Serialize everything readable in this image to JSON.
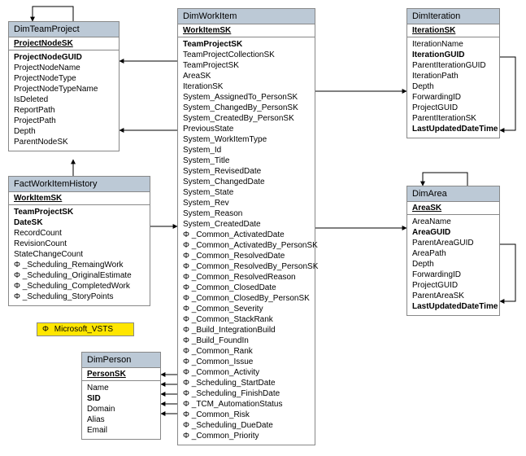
{
  "legend": {
    "symbol": "Φ",
    "label": "Microsoft_VSTS"
  },
  "entities": {
    "dimTeamProject": {
      "title": "DimTeamProject",
      "pk": "ProjectNodeSK",
      "fields": [
        {
          "name": "ProjectNodeGUID",
          "bold": true
        },
        {
          "name": "ProjectNodeName"
        },
        {
          "name": "ProjectNodeType"
        },
        {
          "name": "ProjectNodeTypeName"
        },
        {
          "name": "IsDeleted"
        },
        {
          "name": "ReportPath"
        },
        {
          "name": "ProjectPath"
        },
        {
          "name": "Depth"
        },
        {
          "name": "ParentNodeSK"
        }
      ]
    },
    "factWorkItemHistory": {
      "title": "FactWorkItemHistory",
      "pk": "WorkItemSK",
      "fields": [
        {
          "name": "TeamProjectSK",
          "bold": true
        },
        {
          "name": "DateSK",
          "bold": true
        },
        {
          "name": "RecordCount"
        },
        {
          "name": "RevisionCount"
        },
        {
          "name": "StateChangeCount"
        },
        {
          "name": "Φ _Scheduling_RemaingWork"
        },
        {
          "name": "Φ _Scheduling_OriginalEstimate"
        },
        {
          "name": "Φ _Scheduling_CompletedWork"
        },
        {
          "name": "Φ _Scheduling_StoryPoints"
        }
      ]
    },
    "dimPerson": {
      "title": "DimPerson",
      "pk": "PersonSK",
      "fields": [
        {
          "name": "Name"
        },
        {
          "name": "SID",
          "bold": true
        },
        {
          "name": "Domain"
        },
        {
          "name": "Alias"
        },
        {
          "name": "Email"
        }
      ]
    },
    "dimWorkItem": {
      "title": "DimWorkItem",
      "pk": "WorkItemSK",
      "fields": [
        {
          "name": "TeamProjectSK",
          "bold": true
        },
        {
          "name": "TeamProjectCollectionSK"
        },
        {
          "name": "TeamProjectSK"
        },
        {
          "name": "AreaSK"
        },
        {
          "name": "IterationSK"
        },
        {
          "name": "System_AssignedTo_PersonSK"
        },
        {
          "name": "System_ChangedBy_PersonSK"
        },
        {
          "name": "System_CreatedBy_PersonSK"
        },
        {
          "name": "PreviousState"
        },
        {
          "name": "System_WorkItemType"
        },
        {
          "name": "System_Id"
        },
        {
          "name": "System_Title"
        },
        {
          "name": "System_RevisedDate"
        },
        {
          "name": "System_ChangedDate"
        },
        {
          "name": "System_State"
        },
        {
          "name": "System_Rev"
        },
        {
          "name": "System_Reason"
        },
        {
          "name": "System_CreatedDate"
        },
        {
          "name": "Φ _Common_ActivatedDate"
        },
        {
          "name": "Φ _Common_ActivatedBy_PersonSK"
        },
        {
          "name": "Φ _Common_ResolvedDate"
        },
        {
          "name": "Φ _Common_ResolvedBy_PersonSK"
        },
        {
          "name": "Φ _Common_ResolvedReason"
        },
        {
          "name": "Φ _Common_ClosedDate"
        },
        {
          "name": "Φ _Common_ClosedBy_PersonSK"
        },
        {
          "name": "Φ _Common_Severity"
        },
        {
          "name": "Φ _Common_StackRank"
        },
        {
          "name": "Φ _Build_IntegrationBuild"
        },
        {
          "name": "Φ _Build_FoundIn"
        },
        {
          "name": "Φ _Common_Rank"
        },
        {
          "name": "Φ _Common_Issue"
        },
        {
          "name": "Φ _Common_Activity"
        },
        {
          "name": "Φ _Scheduling_StartDate"
        },
        {
          "name": "Φ _Scheduling_FinishDate"
        },
        {
          "name": "Φ _TCM_AutomationStatus"
        },
        {
          "name": "Φ _Common_Risk"
        },
        {
          "name": "Φ _Scheduling_DueDate"
        },
        {
          "name": "Φ _Common_Priority"
        }
      ]
    },
    "dimIteration": {
      "title": "DimIteration",
      "pk": "IterationSK",
      "fields": [
        {
          "name": "IterationName"
        },
        {
          "name": "IterationGUID",
          "bold": true
        },
        {
          "name": "ParentIterationGUID"
        },
        {
          "name": "IterationPath"
        },
        {
          "name": "Depth"
        },
        {
          "name": "ForwardingID"
        },
        {
          "name": "ProjectGUID"
        },
        {
          "name": "ParentIterationSK"
        },
        {
          "name": "LastUpdatedDateTime",
          "bold": true
        }
      ]
    },
    "dimArea": {
      "title": "DimArea",
      "pk": "AreaSK",
      "fields": [
        {
          "name": "AreaName"
        },
        {
          "name": "AreaGUID",
          "bold": true
        },
        {
          "name": "ParentAreaGUID"
        },
        {
          "name": "AreaPath"
        },
        {
          "name": "Depth"
        },
        {
          "name": "ForwardingID"
        },
        {
          "name": "ProjectGUID"
        },
        {
          "name": "ParentAreaSK"
        },
        {
          "name": "LastUpdatedDateTime",
          "bold": true
        }
      ]
    }
  }
}
